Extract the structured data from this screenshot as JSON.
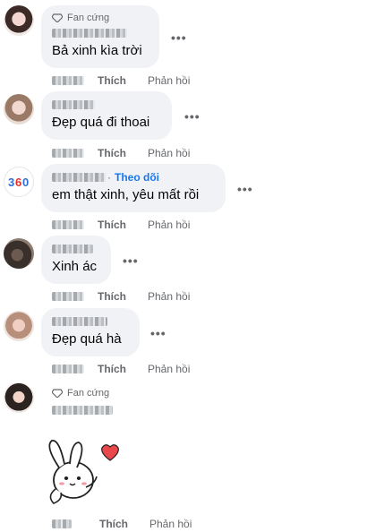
{
  "comments": [
    {
      "badge": "Fan cứng",
      "follow": "",
      "text": "Bả xinh kìa trời",
      "more": "•••",
      "like": "Thích",
      "reply": "Phản hồi"
    },
    {
      "badge": "",
      "follow": "",
      "text": "Đẹp quá đi thoai",
      "more": "•••",
      "like": "Thích",
      "reply": "Phản hồi"
    },
    {
      "badge": "",
      "follow": "Theo dõi",
      "text": "em thật xinh, yêu mất rồi",
      "more": "•••",
      "like": "Thích",
      "reply": "Phản hồi"
    },
    {
      "badge": "",
      "follow": "",
      "text": "Xinh ác",
      "more": "•••",
      "like": "Thích",
      "reply": "Phản hồi"
    },
    {
      "badge": "",
      "follow": "",
      "text": "Đẹp quá hà",
      "more": "•••",
      "like": "Thích",
      "reply": "Phản hồi"
    },
    {
      "badge": "Fan cứng",
      "follow": "",
      "text": "",
      "more": "",
      "like": "Thích",
      "reply": "Phản hồi"
    }
  ],
  "colors": {
    "bubble": "#f0f2f5",
    "link": "#1877f2",
    "muted": "#65676b"
  },
  "icons": {
    "badge": "diamond-icon",
    "sticker": "bunny-heart-sticker"
  }
}
